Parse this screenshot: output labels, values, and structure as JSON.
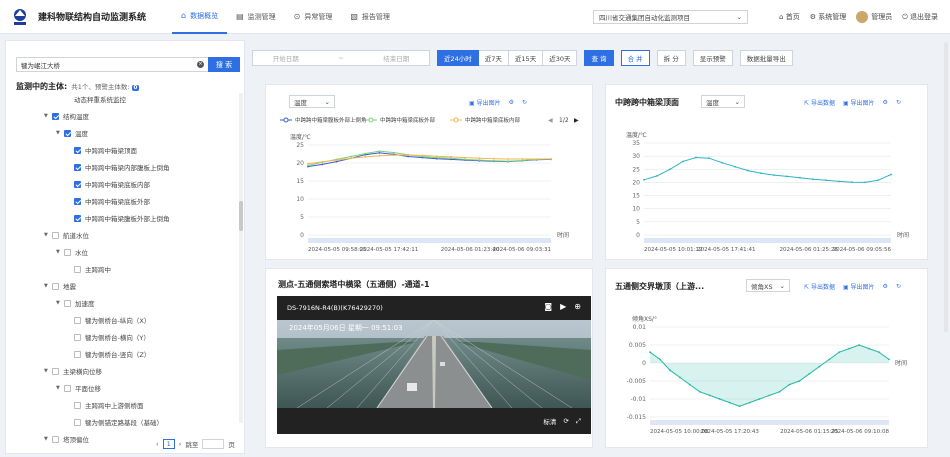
{
  "app": {
    "title": "建科物联结构自动监测系统"
  },
  "nav": [
    {
      "label": "数据概览",
      "icon": "chart-icon",
      "active": true
    },
    {
      "label": "监测管理",
      "icon": "monitor-icon"
    },
    {
      "label": "异常管理",
      "icon": "alert-icon"
    },
    {
      "label": "报告管理",
      "icon": "report-icon"
    }
  ],
  "project": {
    "value": "四川省交通集团自动化监测项目"
  },
  "top_right": {
    "home": "首页",
    "settings": "系统管理",
    "user": "管理员",
    "logout": "退出登录"
  },
  "sidebar": {
    "search_value": "犍为岷江大桥",
    "search_btn": "搜 索",
    "mon_title": "监测中的主体:",
    "mon_sub": "共1个、预警主体数:",
    "warn_count": "0",
    "tree": [
      {
        "label": "动态秤重系统监控",
        "level": 3,
        "caret": false,
        "cb": false
      },
      {
        "label": "结构温度",
        "level": 1,
        "caret": true,
        "cb": true
      },
      {
        "label": "温度",
        "level": 2,
        "caret": true,
        "cb": true
      },
      {
        "label": "中跨跨中箱梁顶面",
        "level": 3,
        "caret": false,
        "cb": true
      },
      {
        "label": "中跨跨中箱梁内部腹板上倒角",
        "level": 3,
        "caret": false,
        "cb": true
      },
      {
        "label": "中跨跨中箱梁底板内部",
        "level": 3,
        "caret": false,
        "cb": true
      },
      {
        "label": "中跨跨中箱梁底板外部",
        "level": 3,
        "caret": false,
        "cb": true
      },
      {
        "label": "中跨跨中箱梁腹板外部上倒角",
        "level": 3,
        "caret": false,
        "cb": true
      },
      {
        "label": "航道水位",
        "level": 1,
        "caret": true,
        "cb": false
      },
      {
        "label": "水位",
        "level": 2,
        "caret": true,
        "cb": false
      },
      {
        "label": "主跨跨中",
        "level": 3,
        "caret": false,
        "cb": false
      },
      {
        "label": "地震",
        "level": 1,
        "caret": true,
        "cb": false
      },
      {
        "label": "加速度",
        "level": 2,
        "caret": true,
        "cb": false
      },
      {
        "label": "犍为侧桥台-纵向（X）",
        "level": 3,
        "caret": false,
        "cb": false
      },
      {
        "label": "犍为侧桥台-横向（Y）",
        "level": 3,
        "caret": false,
        "cb": false
      },
      {
        "label": "犍为侧桥台-竖向（Z）",
        "level": 3,
        "caret": false,
        "cb": false
      },
      {
        "label": "主梁横向位移",
        "level": 1,
        "caret": true,
        "cb": false
      },
      {
        "label": "平面位移",
        "level": 2,
        "caret": true,
        "cb": false
      },
      {
        "label": "主跨跨中上游侧桥面",
        "level": 3,
        "caret": false,
        "cb": false
      },
      {
        "label": "犍为侧锚定路基段（基础）",
        "level": 3,
        "caret": false,
        "cb": false
      },
      {
        "label": "塔顶偏位",
        "level": 1,
        "caret": true,
        "cb": false
      }
    ],
    "pager": {
      "page": "1",
      "goto": "跳至",
      "unit": "页"
    }
  },
  "toolbar": {
    "start": "开始日期",
    "sep": "~",
    "end": "结束日期",
    "ranges": [
      "近24小时",
      "近7天",
      "近15天",
      "近30天"
    ],
    "query": "查 询",
    "merge": "合 并",
    "split": "拆 分",
    "show_warn": "显示预警",
    "export": "数据批量导出"
  },
  "panel1": {
    "select": "温度",
    "export_img": "导出图片",
    "legend": [
      "中跨跨中箱梁腹板外部上倒角",
      "中跨跨中箱梁底板外部",
      "中跨跨中箱梁底板内部"
    ],
    "page": "1/2"
  },
  "panel2": {
    "title": "中跨跨中箱梁顶面",
    "select": "温度",
    "export_data": "导出数据",
    "export_img": "导出图片"
  },
  "panel3": {
    "title": "测点-五通侧索塔中横梁（五通侧）-通道-1",
    "cam": "DS-7916N-R4(B)(K76429270)",
    "stream": "标清",
    "overlay": "2024年05月06日 星期一 09:51:03"
  },
  "panel4": {
    "title": "五通侧交界墩顶（上游...",
    "select": "倾角XS",
    "export_data": "导出数据",
    "export_img": "导出图片"
  },
  "chart_data": [
    {
      "type": "line",
      "ylabel": "温度/℃",
      "xlabel": "时间",
      "ylim": [
        0,
        25
      ],
      "yticks": [
        0,
        5,
        10,
        15,
        20,
        25
      ],
      "xticks": [
        "2024-05-05 09:58:05",
        "2024-05-05 17:42:11",
        "2024-05-06 01:23:40",
        "2024-05-06 09:03:31"
      ],
      "series": [
        {
          "name": "中跨跨中箱梁腹板外部上倒角",
          "color": "#3b5bd6",
          "values": [
            19.0,
            19.6,
            20.4,
            21.3,
            22.3,
            22.8,
            22.4,
            21.8,
            21.5,
            21.2,
            21.0,
            20.8,
            20.6,
            20.5,
            20.4,
            20.6,
            20.9,
            21.0
          ]
        },
        {
          "name": "中跨跨中箱梁底板外部",
          "color": "#7bd07b",
          "values": [
            19.3,
            20.2,
            21.0,
            21.8,
            22.6,
            23.3,
            22.9,
            22.3,
            21.8,
            21.5,
            21.3,
            21.0,
            20.8,
            20.6,
            20.5,
            20.7,
            21.0,
            21.1
          ]
        },
        {
          "name": "中跨跨中箱梁底板内部",
          "color": "#f2b84b",
          "values": [
            19.8,
            20.3,
            20.8,
            21.3,
            21.7,
            22.0,
            22.2,
            22.2,
            22.1,
            21.9,
            21.7,
            21.5,
            21.3,
            21.2,
            21.1,
            21.1,
            21.1,
            21.1
          ]
        }
      ]
    },
    {
      "type": "line",
      "ylabel": "温度/℃",
      "xlabel": "时间",
      "ylim": [
        0,
        35
      ],
      "yticks": [
        0,
        5,
        10,
        15,
        20,
        25,
        30,
        35
      ],
      "xticks": [
        "2024-05-05 10:01:12",
        "2024-05-05 17:41:41",
        "2024-05-06 01:25:26",
        "2024-05-06 09:05:56"
      ],
      "series": [
        {
          "name": "中跨跨中箱梁顶面",
          "color": "#2bb3c6",
          "values": [
            21,
            22.5,
            25,
            28,
            29.5,
            29.2,
            27.5,
            26,
            24.5,
            23.5,
            22.8,
            22.3,
            21.8,
            21.2,
            20.8,
            20.4,
            20.1,
            20,
            20.8,
            23
          ]
        }
      ]
    },
    {
      "type": "area",
      "ylabel": "倾角XS/°",
      "xlabel": "时间",
      "ylim": [
        -0.015,
        0.01
      ],
      "yticks": [
        0.01,
        0.005,
        0,
        -0.005,
        -0.01,
        -0.015
      ],
      "xticks": [
        "2024-05-05 10:00:08",
        "2024-05-05 17:20:43",
        "2024-05-06 01:15:25",
        "2024-05-06 09:10:08"
      ],
      "series": [
        {
          "name": "倾角XS",
          "color": "#23b8a4",
          "values": [
            0.003,
            0.001,
            -0.002,
            -0.004,
            -0.006,
            -0.008,
            -0.009,
            -0.01,
            -0.011,
            -0.012,
            -0.011,
            -0.01,
            -0.009,
            -0.008,
            -0.006,
            -0.005,
            -0.003,
            -0.001,
            0.001,
            0.003,
            0.004,
            0.005,
            0.004,
            0.003,
            0.001
          ]
        }
      ]
    }
  ]
}
